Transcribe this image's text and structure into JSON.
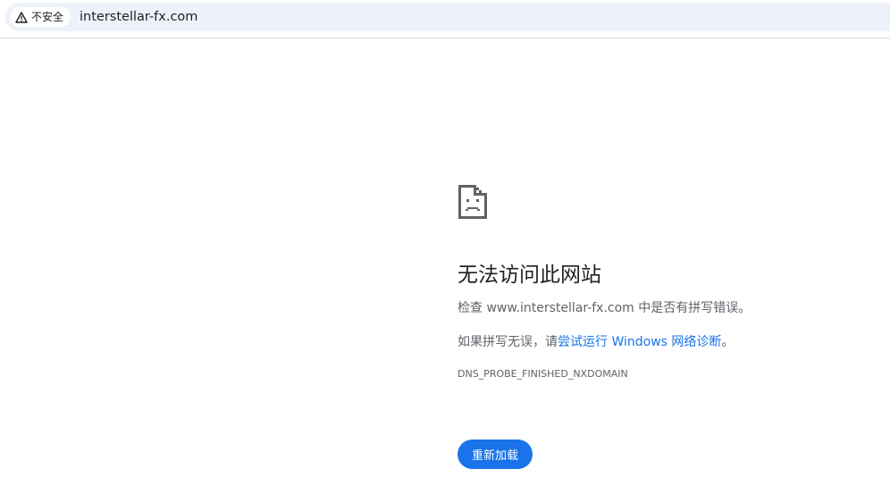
{
  "address_bar": {
    "security_label": "不安全",
    "security_icon": "warning-triangle-icon",
    "url": "interstellar-fx.com"
  },
  "error_page": {
    "icon": "sad-page-icon",
    "title": "无法访问此网站",
    "check_text": "检查 www.interstellar-fx.com 中是否有拼写错误。",
    "diagnostics_prefix": "如果拼写无误，请",
    "diagnostics_link": "尝试运行 Windows 网络诊断",
    "diagnostics_suffix": "。",
    "error_code": "DNS_PROBE_FINISHED_NXDOMAIN",
    "reload_button": "重新加载"
  },
  "colors": {
    "accent": "#1a73e8",
    "omnibox_background": "#edf2fa",
    "title_text": "#202124",
    "body_text": "#5f6368"
  }
}
